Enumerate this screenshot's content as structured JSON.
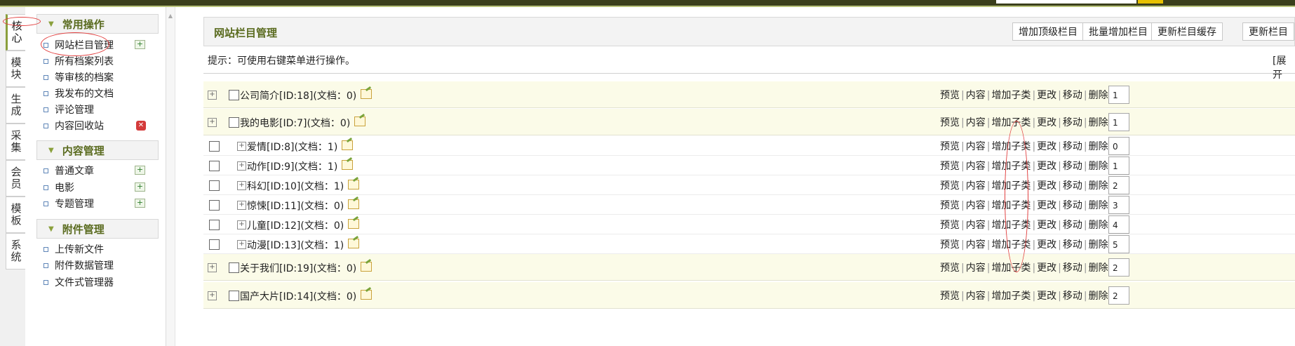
{
  "vertical_tabs": [
    "核心",
    "模块",
    "生成",
    "采集",
    "会员",
    "模板",
    "系统"
  ],
  "sidebar": {
    "groups": [
      {
        "title": "常用操作",
        "items": [
          "网站栏目管理",
          "所有档案列表",
          "等审核的档案",
          "我发布的文档",
          "评论管理",
          "内容回收站"
        ]
      },
      {
        "title": "内容管理",
        "items": [
          "普通文章",
          "电影",
          "专题管理"
        ]
      },
      {
        "title": "附件管理",
        "items": [
          "上传新文件",
          "附件数据管理",
          "文件式管理器"
        ]
      }
    ]
  },
  "main": {
    "title": "网站栏目管理",
    "buttons": [
      "增加顶级栏目",
      "批量增加栏目",
      "更新栏目缓存",
      "更新栏目"
    ],
    "tip": "提示：可使用右键菜单进行操作。",
    "expand": "[展开",
    "actions": [
      "预览",
      "内容",
      "增加子类",
      "更改",
      "移动",
      "删除"
    ],
    "rows": [
      {
        "label": "公司简介[ID:18](文档：0)",
        "order": "1"
      },
      {
        "label": "我的电影[ID:7](文档：0)",
        "order": "1"
      },
      {
        "label": "爱情[ID:8](文档：1)",
        "order": "0"
      },
      {
        "label": "动作[ID:9](文档：1)",
        "order": "1"
      },
      {
        "label": "科幻[ID:10](文档：1)",
        "order": "2"
      },
      {
        "label": "惊悚[ID:11](文档：0)",
        "order": "3"
      },
      {
        "label": "儿童[ID:12](文档：0)",
        "order": "4"
      },
      {
        "label": "动漫[ID:13](文档：1)",
        "order": "5"
      },
      {
        "label": "关于我们[ID:19](文档：0)",
        "order": "2"
      },
      {
        "label": "国产大片[ID:14](文档：0)",
        "order": "2"
      }
    ]
  },
  "colors": {
    "accent": "#5a6b1f",
    "highlight_row": "#fbfbe8",
    "annotation": "#e24040"
  }
}
